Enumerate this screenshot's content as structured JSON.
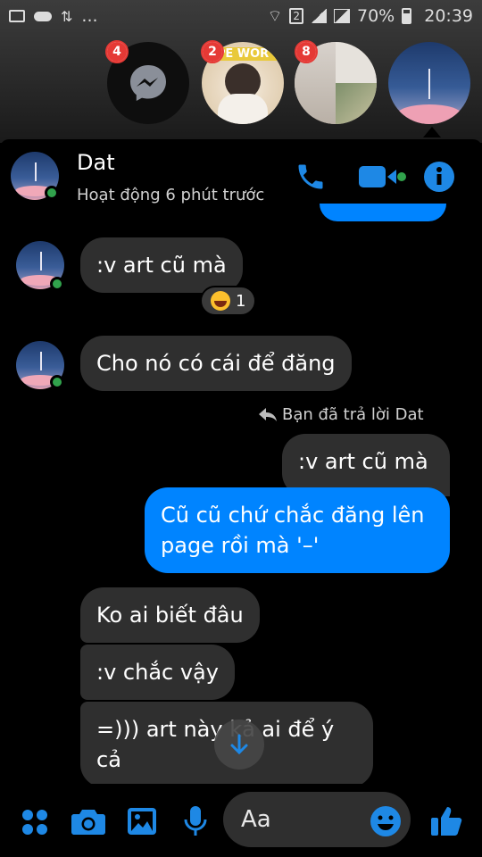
{
  "status_bar": {
    "battery": "70%",
    "time": "20:39",
    "sim_slot": "2",
    "ellipsis": "..."
  },
  "chat_heads": [
    {
      "name": "messenger-head",
      "badge": "4"
    },
    {
      "name": "photo-head-1",
      "badge": "2",
      "banner": "PE WOR"
    },
    {
      "name": "photo-head-2",
      "badge": "8"
    },
    {
      "name": "dat-head",
      "badge": ""
    }
  ],
  "header": {
    "name": "Dat",
    "status": "Hoạt động 6 phút trước"
  },
  "messages": {
    "m1": ":v art cũ mà",
    "m1_reaction_count": "1",
    "m2": "Cho nó có cái để đăng",
    "reply_note": "Bạn đã trả lời Dat",
    "quoted": ":v art cũ mà",
    "reply": "Cũ cũ chứ chắc đăng lên page rồi mà '–'",
    "m3": "Ko ai biết đâu",
    "m4": ":v chắc vậy",
    "m5": "=))) art này kả ai để ý cả"
  },
  "composer": {
    "placeholder": "Aa"
  },
  "colors": {
    "accent": "#0084FF",
    "icon_blue": "#1E88E5",
    "bubble_gray": "#2F2F2F",
    "online_green": "#31A24C",
    "badge_red": "#E53935"
  }
}
